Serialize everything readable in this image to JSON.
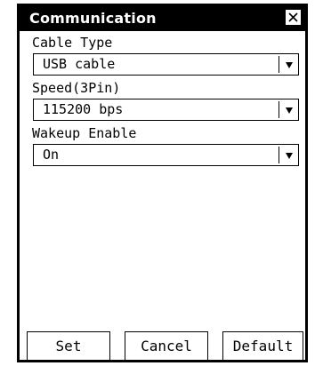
{
  "dialog": {
    "title": "Communication",
    "close_icon": "close-icon"
  },
  "fields": [
    {
      "label": "Cable Type",
      "value": "USB cable"
    },
    {
      "label": "Speed(3Pin)",
      "value": "115200 bps"
    },
    {
      "label": "Wakeup Enable",
      "value": "On"
    }
  ],
  "buttons": {
    "set": "Set",
    "cancel": "Cancel",
    "default": "Default"
  }
}
